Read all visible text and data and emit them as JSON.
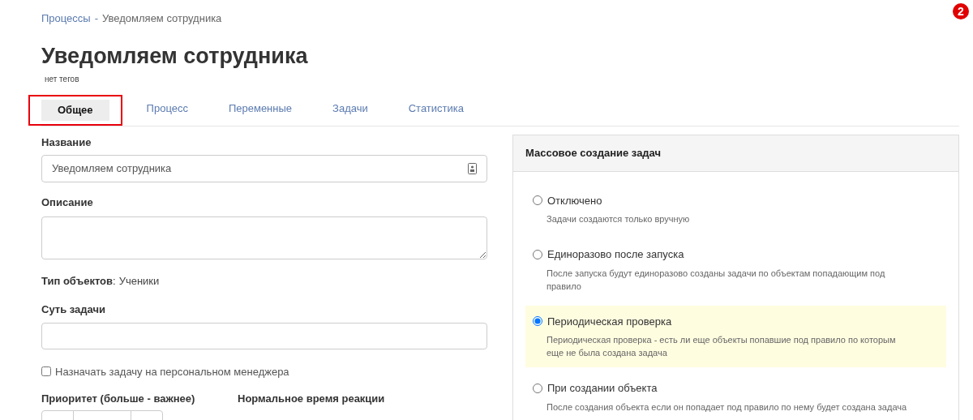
{
  "breadcrumb": {
    "link": "Процессы",
    "separator": "-",
    "current": "Уведомляем сотрудника"
  },
  "badge": "2",
  "title": "Уведомляем сотрудника",
  "tags": "нет тегов",
  "tabs": [
    {
      "label": "Общее",
      "selected": true,
      "highlighted": true
    },
    {
      "label": "Процесс",
      "selected": false,
      "highlighted": false
    },
    {
      "label": "Переменные",
      "selected": false,
      "highlighted": false
    },
    {
      "label": "Задачи",
      "selected": false,
      "highlighted": false
    },
    {
      "label": "Статистика",
      "selected": false,
      "highlighted": false
    }
  ],
  "form": {
    "name": {
      "label": "Название",
      "value": "Уведомляем сотрудника"
    },
    "description": {
      "label": "Описание"
    },
    "object_type": {
      "label": "Тип объектов",
      "separator": ":",
      "value": "Ученики"
    },
    "task_essence": {
      "label": "Суть задачи"
    },
    "assign_manager": {
      "label": "Назначать задачу на персональном менеджера",
      "checked": false
    },
    "priority": {
      "label": "Приоритет (больше - важнее)"
    },
    "reaction_time": {
      "label": "Нормальное время реакции"
    }
  },
  "mass_creation": {
    "title": "Массовое создание задач",
    "options": [
      {
        "label": "Отключено",
        "description": "Задачи создаются только вручную",
        "selected": false
      },
      {
        "label": "Единоразово после запуска",
        "description": "После запуска будут единоразово созданы задачи по объектам попадающим под правило",
        "selected": false
      },
      {
        "label": "Периодическая проверка",
        "description": "Периодическая проверка - есть ли еще объекты попавшие под правило по которым еще не была создана задача",
        "selected": true
      },
      {
        "label": "При создании объекта",
        "description": "После создания объекта если он попадает под правило по нему будет создана задача",
        "selected": false
      }
    ]
  }
}
